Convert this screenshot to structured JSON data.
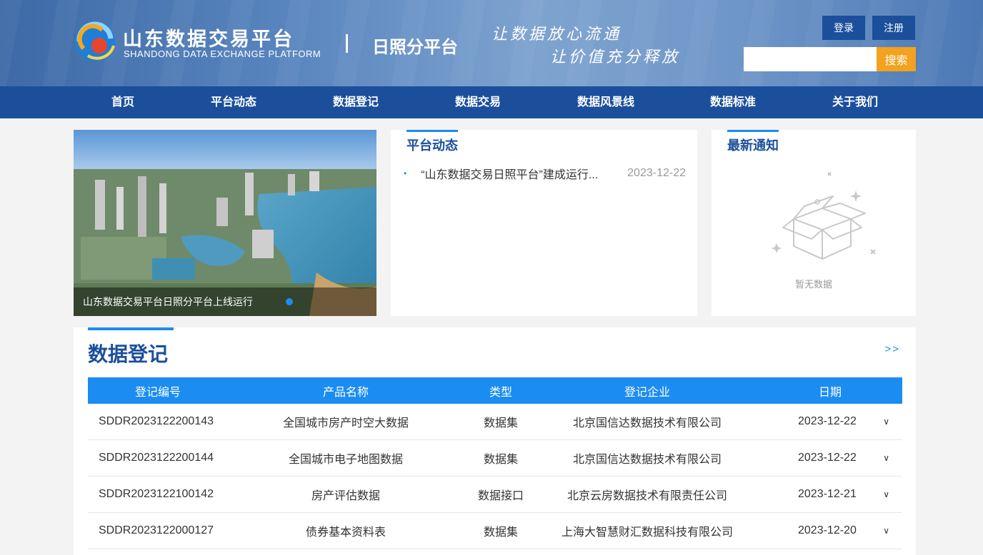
{
  "header": {
    "brand_title": "山东数据交易平台",
    "brand_subtitle": "SHANDONG DATA EXCHANGE PLATFORM",
    "branch": "日照分平台",
    "slogan_line1": "让数据放心流通",
    "slogan_line2": "让价值充分释放",
    "login_label": "登录",
    "register_label": "注册",
    "search_value": "",
    "search_label": "搜索"
  },
  "nav": {
    "items": [
      "首页",
      "平台动态",
      "数据登记",
      "数据交易",
      "数据风景线",
      "数据标准",
      "关于我们"
    ]
  },
  "banner": {
    "caption": "山东数据交易平台日照分平台上线运行"
  },
  "news": {
    "title": "平台动态",
    "items": [
      {
        "text": "“山东数据交易日照平台”建成运行...",
        "date": "2023-12-22"
      }
    ]
  },
  "notice": {
    "title": "最新通知",
    "empty_text": "暂无数据"
  },
  "registry": {
    "title": "数据登记",
    "more": ">>",
    "columns": [
      "登记编号",
      "产品名称",
      "类型",
      "登记企业",
      "日期"
    ],
    "rows": [
      {
        "id": "SDDR2023122200143",
        "name": "全国城市房产时空大数据",
        "type": "数据集",
        "company": "北京国信达数据技术有限公司",
        "date": "2023-12-22"
      },
      {
        "id": "SDDR2023122200144",
        "name": "全国城市电子地图数据",
        "type": "数据集",
        "company": "北京国信达数据技术有限公司",
        "date": "2023-12-22"
      },
      {
        "id": "SDDR2023122100142",
        "name": "房产评估数据",
        "type": "数据接口",
        "company": "北京云房数据技术有限责任公司",
        "date": "2023-12-21"
      },
      {
        "id": "SDDR2023122000127",
        "name": "债券基本资料表",
        "type": "数据集",
        "company": "上海大智慧财汇数据科技有限公司",
        "date": "2023-12-20"
      }
    ],
    "expand_icon": "chevron-down-icon"
  },
  "colors": {
    "primary": "#1b4f9c",
    "accent": "#1b8cf2",
    "search": "#f2a21d"
  }
}
